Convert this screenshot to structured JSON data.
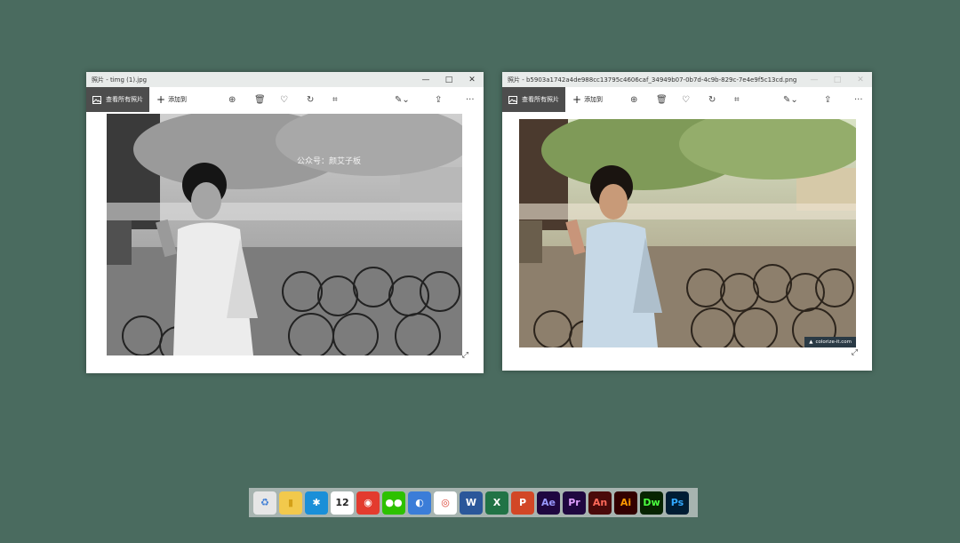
{
  "window1": {
    "title": "照片 - timg (1).jpg",
    "all_photos_label": "查看所有照片",
    "add_to_label": "添加到",
    "watermark": "公众号：颜艾子板",
    "image_desc": "grayscale photo"
  },
  "window2": {
    "title": "照片 - b5903a1742a4de988cc13795c4606caf_34949b07-0b7d-4c9b-829c-7e4e9f5c13cd.png",
    "all_photos_label": "查看所有照片",
    "add_to_label": "添加到",
    "badge_text": "colorize-it.com"
  },
  "window_controls": {
    "minimize": "—",
    "maximize": "□",
    "close": "✕"
  },
  "toolbar_icons": [
    "zoom-in-icon",
    "delete-icon",
    "heart-icon",
    "rotate-icon",
    "crop-icon",
    "edit-create-icon",
    "share-icon",
    "more-icon"
  ],
  "dock": [
    {
      "name": "recycle-bin",
      "label": "♻",
      "color": "#e6e6e6",
      "fg": "#3a7bd5"
    },
    {
      "name": "file-explorer",
      "label": "▮",
      "color": "#f2c94c",
      "fg": "#d4a017"
    },
    {
      "name": "app-star",
      "label": "✱",
      "color": "#1a8fd8",
      "fg": "#ffffff"
    },
    {
      "name": "calendar",
      "label": "12",
      "color": "#ffffff",
      "fg": "#222222"
    },
    {
      "name": "netease-music",
      "label": "◉",
      "color": "#e33b2e",
      "fg": "#ffffff"
    },
    {
      "name": "wechat",
      "label": "●●",
      "color": "#2dc100",
      "fg": "#ffffff"
    },
    {
      "name": "app-blue-circle",
      "label": "◐",
      "color": "#3b7dd8",
      "fg": "#ffffff"
    },
    {
      "name": "chrome",
      "label": "◎",
      "color": "#ffffff",
      "fg": "#db4437"
    },
    {
      "name": "word",
      "label": "W",
      "color": "#2b579a",
      "fg": "#ffffff"
    },
    {
      "name": "excel",
      "label": "X",
      "color": "#217346",
      "fg": "#ffffff"
    },
    {
      "name": "powerpoint",
      "label": "P",
      "color": "#d24726",
      "fg": "#ffffff"
    },
    {
      "name": "after-effects",
      "label": "Ae",
      "color": "#1f0740",
      "fg": "#9999ff"
    },
    {
      "name": "premiere",
      "label": "Pr",
      "color": "#1f0740",
      "fg": "#e0a0ff"
    },
    {
      "name": "animate",
      "label": "An",
      "color": "#4a0a0a",
      "fg": "#ff6a5a"
    },
    {
      "name": "illustrator",
      "label": "Ai",
      "color": "#330000",
      "fg": "#ff9a00"
    },
    {
      "name": "dreamweaver",
      "label": "Dw",
      "color": "#072401",
      "fg": "#4bff3f"
    },
    {
      "name": "photoshop",
      "label": "Ps",
      "color": "#001d34",
      "fg": "#31a8ff"
    }
  ]
}
